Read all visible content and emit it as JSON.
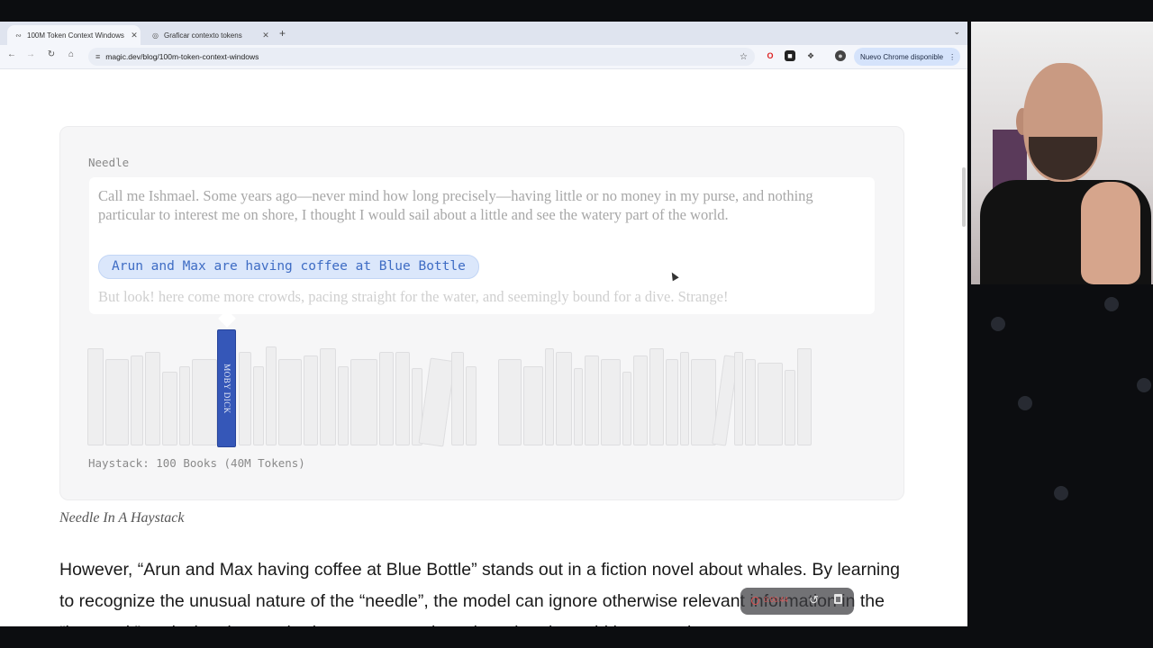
{
  "browser": {
    "tabs": [
      {
        "label": "100M Token Context Windows",
        "active": true,
        "icon": "magic-logo-icon"
      },
      {
        "label": "Graficar contexto tokens",
        "active": false,
        "icon": "globe-icon"
      }
    ],
    "url": "magic.dev/blog/100m-token-context-windows",
    "update_chip": "Nuevo Chrome disponible"
  },
  "figure": {
    "needle_label": "Needle",
    "passage": "Call me Ishmael. Some years ago—never mind how long precisely—having little or no money in my purse, and nothing particular to interest me on shore, I thought I would sail about a little and see the watery part of the world.",
    "needle_text": "Arun and Max are having coffee at Blue Bottle",
    "passage_after": "But look! here come more crowds, pacing straight for the water, and seemingly bound for a dive. Strange!",
    "needle_book_title": "MOBY DICK",
    "haystack_label": "Haystack: 100 Books (40M Tokens)"
  },
  "caption": "Needle In A Haystack",
  "body_text": "However, “Arun and Max having coffee at Blue Bottle” stands out in a fiction novel about whales. By learning to recognize the unusual nature of the “needle”, the model can ignore otherwise relevant information in the “haystack”, reducing the required storage capacity to less than it would be on real",
  "recorder": {
    "time": "0:00:44",
    "accent": "#e05a5a"
  },
  "colors": {
    "needle_book": "#3557b8",
    "highlight_bg": "#dbe7fb",
    "highlight_text": "#3e6cc4"
  }
}
